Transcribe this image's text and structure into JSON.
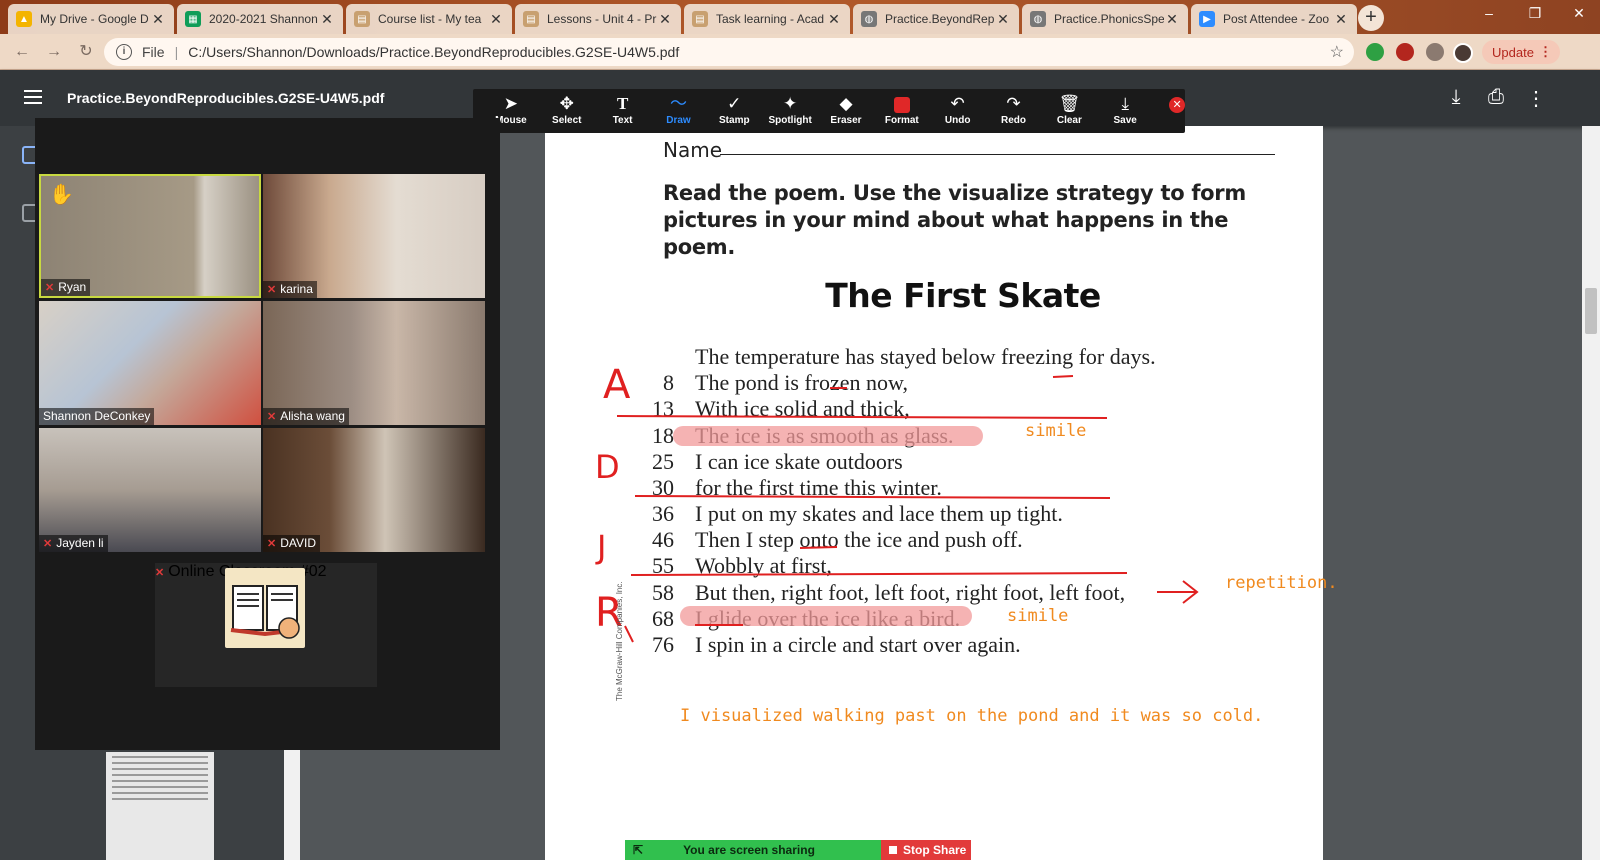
{
  "browser": {
    "tabs": [
      {
        "label": "My Drive - Google D",
        "icon": "google-drive-icon",
        "color": "#f4b400",
        "active": false
      },
      {
        "label": "2020-2021 Shannon",
        "icon": "google-sheets-icon",
        "color": "#0f9d58",
        "active": false
      },
      {
        "label": "Course list - My tea",
        "icon": "document-icon",
        "color": "#c8a070",
        "active": false
      },
      {
        "label": "Lessons - Unit 4 - Pr",
        "icon": "document-icon",
        "color": "#c8a070",
        "active": false
      },
      {
        "label": "Task learning - Acad",
        "icon": "document-icon",
        "color": "#c8a070",
        "active": false
      },
      {
        "label": "Practice.BeyondRep",
        "icon": "globe-icon",
        "color": "#777777",
        "active": true
      },
      {
        "label": "Practice.PhonicsSpe",
        "icon": "globe-icon",
        "color": "#777777",
        "active": false
      },
      {
        "label": "Post Attendee - Zoo",
        "icon": "zoom-icon",
        "color": "#2d8cff",
        "active": false
      }
    ],
    "address": {
      "scheme_label": "File",
      "url": "C:/Users/Shannon/Downloads/Practice.BeyondReproducibles.G2SE-U4W5.pdf"
    },
    "update_label": "Update"
  },
  "pdf_viewer": {
    "title": "Practice.BeyondReproducibles.G2SE-U4W5.pdf"
  },
  "zoom_toolbar": {
    "tools": [
      {
        "label": "Mouse",
        "icon": "cursor-icon",
        "active": false
      },
      {
        "label": "Select",
        "icon": "move-icon",
        "active": false
      },
      {
        "label": "Text",
        "icon": "text-icon",
        "active": false
      },
      {
        "label": "Draw",
        "icon": "draw-icon",
        "active": true
      },
      {
        "label": "Stamp",
        "icon": "checkmark-icon",
        "active": false
      },
      {
        "label": "Spotlight",
        "icon": "spotlight-icon",
        "active": false
      },
      {
        "label": "Eraser",
        "icon": "eraser-icon",
        "active": false
      },
      {
        "label": "Format",
        "icon": "format-icon",
        "active": false
      },
      {
        "label": "Undo",
        "icon": "undo-icon",
        "active": false
      },
      {
        "label": "Redo",
        "icon": "redo-icon",
        "active": false
      },
      {
        "label": "Clear",
        "icon": "trash-icon",
        "active": false
      },
      {
        "label": "Save",
        "icon": "save-icon",
        "active": false
      }
    ],
    "accent": "#2d8cff"
  },
  "gallery": {
    "participants": [
      {
        "name": "Ryan",
        "hand_raised": true
      },
      {
        "name": "karina",
        "hand_raised": false
      },
      {
        "name": "Shannon DeConkey",
        "hand_raised": false
      },
      {
        "name": "Alisha wang",
        "hand_raised": false
      },
      {
        "name": "Jayden li",
        "hand_raised": false
      },
      {
        "name": "DAVID",
        "hand_raised": false
      }
    ],
    "classroom": {
      "name": "Online Classroom #02"
    }
  },
  "worksheet": {
    "name_label": "Name",
    "instructions": "Read the poem. Use the visualize strategy to form pictures in your mind about what happens in the poem.",
    "title": "The First Skate",
    "lines": [
      {
        "num": "",
        "text": "The temperature has stayed below freezing for days."
      },
      {
        "num": "8",
        "text": "The pond is frozen now,"
      },
      {
        "num": "13",
        "text": "With ice solid and thick,"
      },
      {
        "num": "18",
        "text": "The ice is as smooth as glass."
      },
      {
        "num": "25",
        "text": "I can ice skate outdoors"
      },
      {
        "num": "30",
        "text": "for the first time this winter."
      },
      {
        "num": "36",
        "text": "I put on my skates and lace them up tight."
      },
      {
        "num": "46",
        "text": "Then I step onto the ice and push off."
      },
      {
        "num": "55",
        "text": "Wobbly at first,"
      },
      {
        "num": "58",
        "text": "But then, right foot, left foot, right foot, left foot,"
      },
      {
        "num": "68",
        "text": "I glide over the ice like a bird."
      },
      {
        "num": "76",
        "text": "I spin in a circle and start over again."
      }
    ],
    "credit": "The McGraw-Hill Companies, Inc.",
    "notes": {
      "simile_1": "simile",
      "repetition": "repetition.",
      "simile_2": "simile",
      "visualized": "I visualized walking past on the pond and it was so cold."
    },
    "markers": {
      "a": "A",
      "d": "D",
      "j": "J",
      "r": "R"
    }
  },
  "screen_share": {
    "message": "You are screen sharing",
    "stop_label": "Stop Share"
  }
}
